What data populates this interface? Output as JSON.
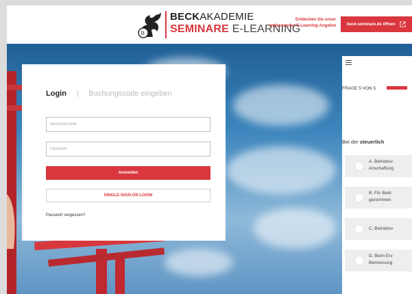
{
  "header": {
    "logo_line1_bold": "BECK",
    "logo_line1_rest": "AKADEMIE",
    "logo_line2_bold": "SEMINARE",
    "logo_line2_rest": " E-LEARNING",
    "promo_line1": "Entdecken Sie unser",
    "promo_line2": "umfassendes E-Learning-Angebot",
    "promo_button": "beck-seminare.de öffnen",
    "accent_color": "#d9363e"
  },
  "login": {
    "tab_login": "Login",
    "tab_separator": "|",
    "tab_booking": "Buchungscode eingeben",
    "username_placeholder": "Benutzername",
    "password_placeholder": "Passwort",
    "login_button": "Anmelden",
    "sso_button": "SINGLE-SIGN-ON LOGIN",
    "forgot_link": "Passwort vergessen?"
  },
  "quiz": {
    "menu_icon": "hamburger-icon",
    "frage_label": "FRAGE 5 VON 5",
    "progress": 1.0,
    "question_prefix": "Bei der ",
    "question_bold": "steuerlich",
    "options": [
      {
        "line1": "A. Betriebsv",
        "line2": "Anschaffung"
      },
      {
        "line1": "B. Für Betri",
        "line2": "genommen"
      },
      {
        "line1": "C. Betriebsv",
        "line2": ""
      },
      {
        "line1": "D. Beim Erv",
        "line2": "Bemessung"
      }
    ]
  }
}
